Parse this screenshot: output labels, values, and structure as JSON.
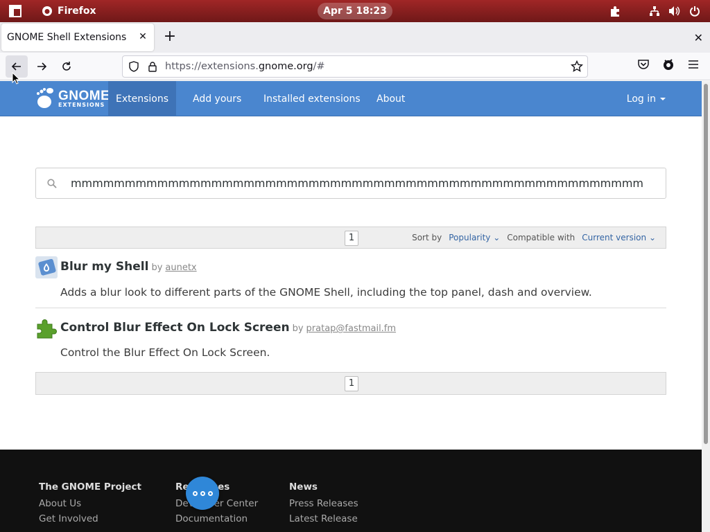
{
  "system": {
    "app_name": "Firefox",
    "clock": "Apr 5  18:23"
  },
  "browser": {
    "tab_title": "GNOME Shell Extensions",
    "url_prefix": "https://extensions.",
    "url_host": "gnome.org",
    "url_suffix": "/#"
  },
  "site": {
    "logo_main": "GNOME",
    "logo_sub": "EXTENSIONS",
    "nav": [
      "Extensions",
      "Add yours",
      "Installed extensions",
      "About"
    ],
    "login": "Log in"
  },
  "search": {
    "value": "mmmmmmmmmmmmmmmmmmmmmmmmmmmmmmmmmmmmmmmmmmmmmmmmmmmmmmmmmmmmmmmmmmmmmmmmmm"
  },
  "pager": {
    "page": "1",
    "sort_by_label": "Sort by",
    "sort_by_value": "Popularity",
    "compat_label": "Compatible with",
    "compat_value": "Current version"
  },
  "extensions": [
    {
      "name": "Blur my Shell",
      "by": "by",
      "author": "aunetx",
      "description": "Adds a blur look to different parts of the GNOME Shell, including the top panel, dash and overview."
    },
    {
      "name": "Control Blur Effect On Lock Screen",
      "by": "by",
      "author": "pratap@fastmail.fm",
      "description": "Control the Blur Effect On Lock Screen."
    }
  ],
  "footer": {
    "col1": [
      "The GNOME Project",
      "About Us",
      "Get Involved"
    ],
    "col2": [
      "Resources",
      "Developer Center",
      "Documentation"
    ],
    "col3": [
      "News",
      "Press Releases",
      "Latest Release"
    ]
  },
  "colors": {
    "topbar": "#8b1e1e",
    "site_nav": "#4a86cf",
    "fab": "#2f87d8"
  }
}
